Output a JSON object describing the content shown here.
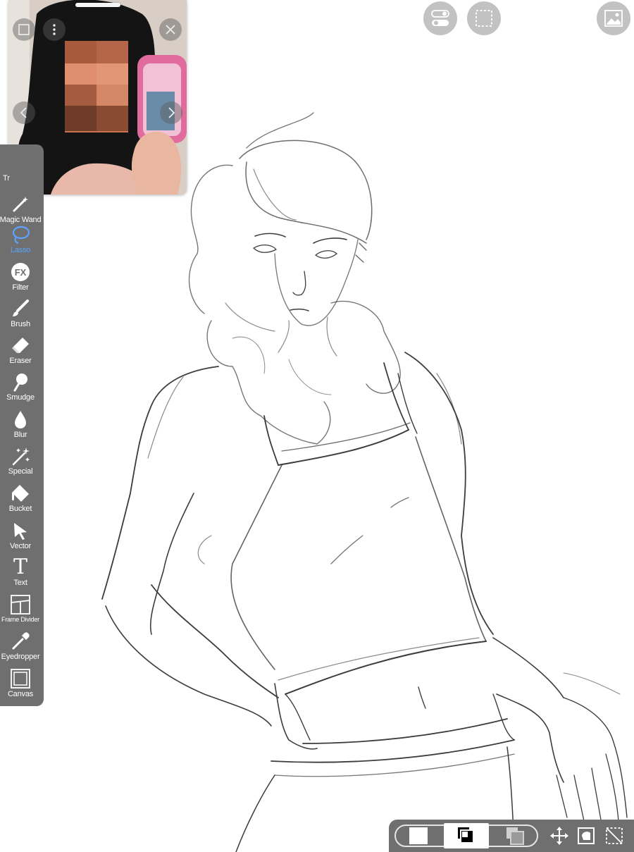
{
  "toolbar": {
    "items": [
      {
        "label": "Magic Wand",
        "icon": "magic-wand-icon"
      },
      {
        "label": "Lasso",
        "icon": "lasso-icon",
        "active": true
      },
      {
        "label": "Filter",
        "icon": "fx-filter-icon",
        "glyph": "FX"
      },
      {
        "label": "Brush",
        "icon": "brush-icon"
      },
      {
        "label": "Eraser",
        "icon": "eraser-icon"
      },
      {
        "label": "Smudge",
        "icon": "smudge-icon"
      },
      {
        "label": "Blur",
        "icon": "blur-drop-icon"
      },
      {
        "label": "Special",
        "icon": "sparkle-icon"
      },
      {
        "label": "Bucket",
        "icon": "bucket-icon"
      },
      {
        "label": "Vector",
        "icon": "arrow-pointer-icon"
      },
      {
        "label": "Text",
        "icon": "text-icon",
        "glyph": "T"
      },
      {
        "label": "Frame Divider",
        "icon": "frame-divider-icon"
      },
      {
        "label": "Eyedropper",
        "icon": "eyedropper-icon"
      },
      {
        "label": "Canvas",
        "icon": "canvas-icon"
      }
    ],
    "partial_label": "Tr"
  },
  "colors": {
    "toolbar_bg": "#6f6f6f",
    "active_tool": "#5da3ff",
    "round_button_bg": "#c2c2c2",
    "sketch_stroke": "#3c3c3c"
  },
  "reference_window": {
    "icons": [
      "square-icon",
      "more-vertical-icon",
      "close-icon",
      "chevron-left-icon",
      "chevron-right-icon"
    ]
  },
  "top_buttons": [
    "toggle-icon",
    "selection-icon",
    "gallery-icon"
  ],
  "bottom_bar": {
    "icons": [
      "white-layer-swatch",
      "black-white-layers-icon",
      "gray-layers-icon",
      "move-icon",
      "transform-icon",
      "deselect-icon"
    ]
  }
}
